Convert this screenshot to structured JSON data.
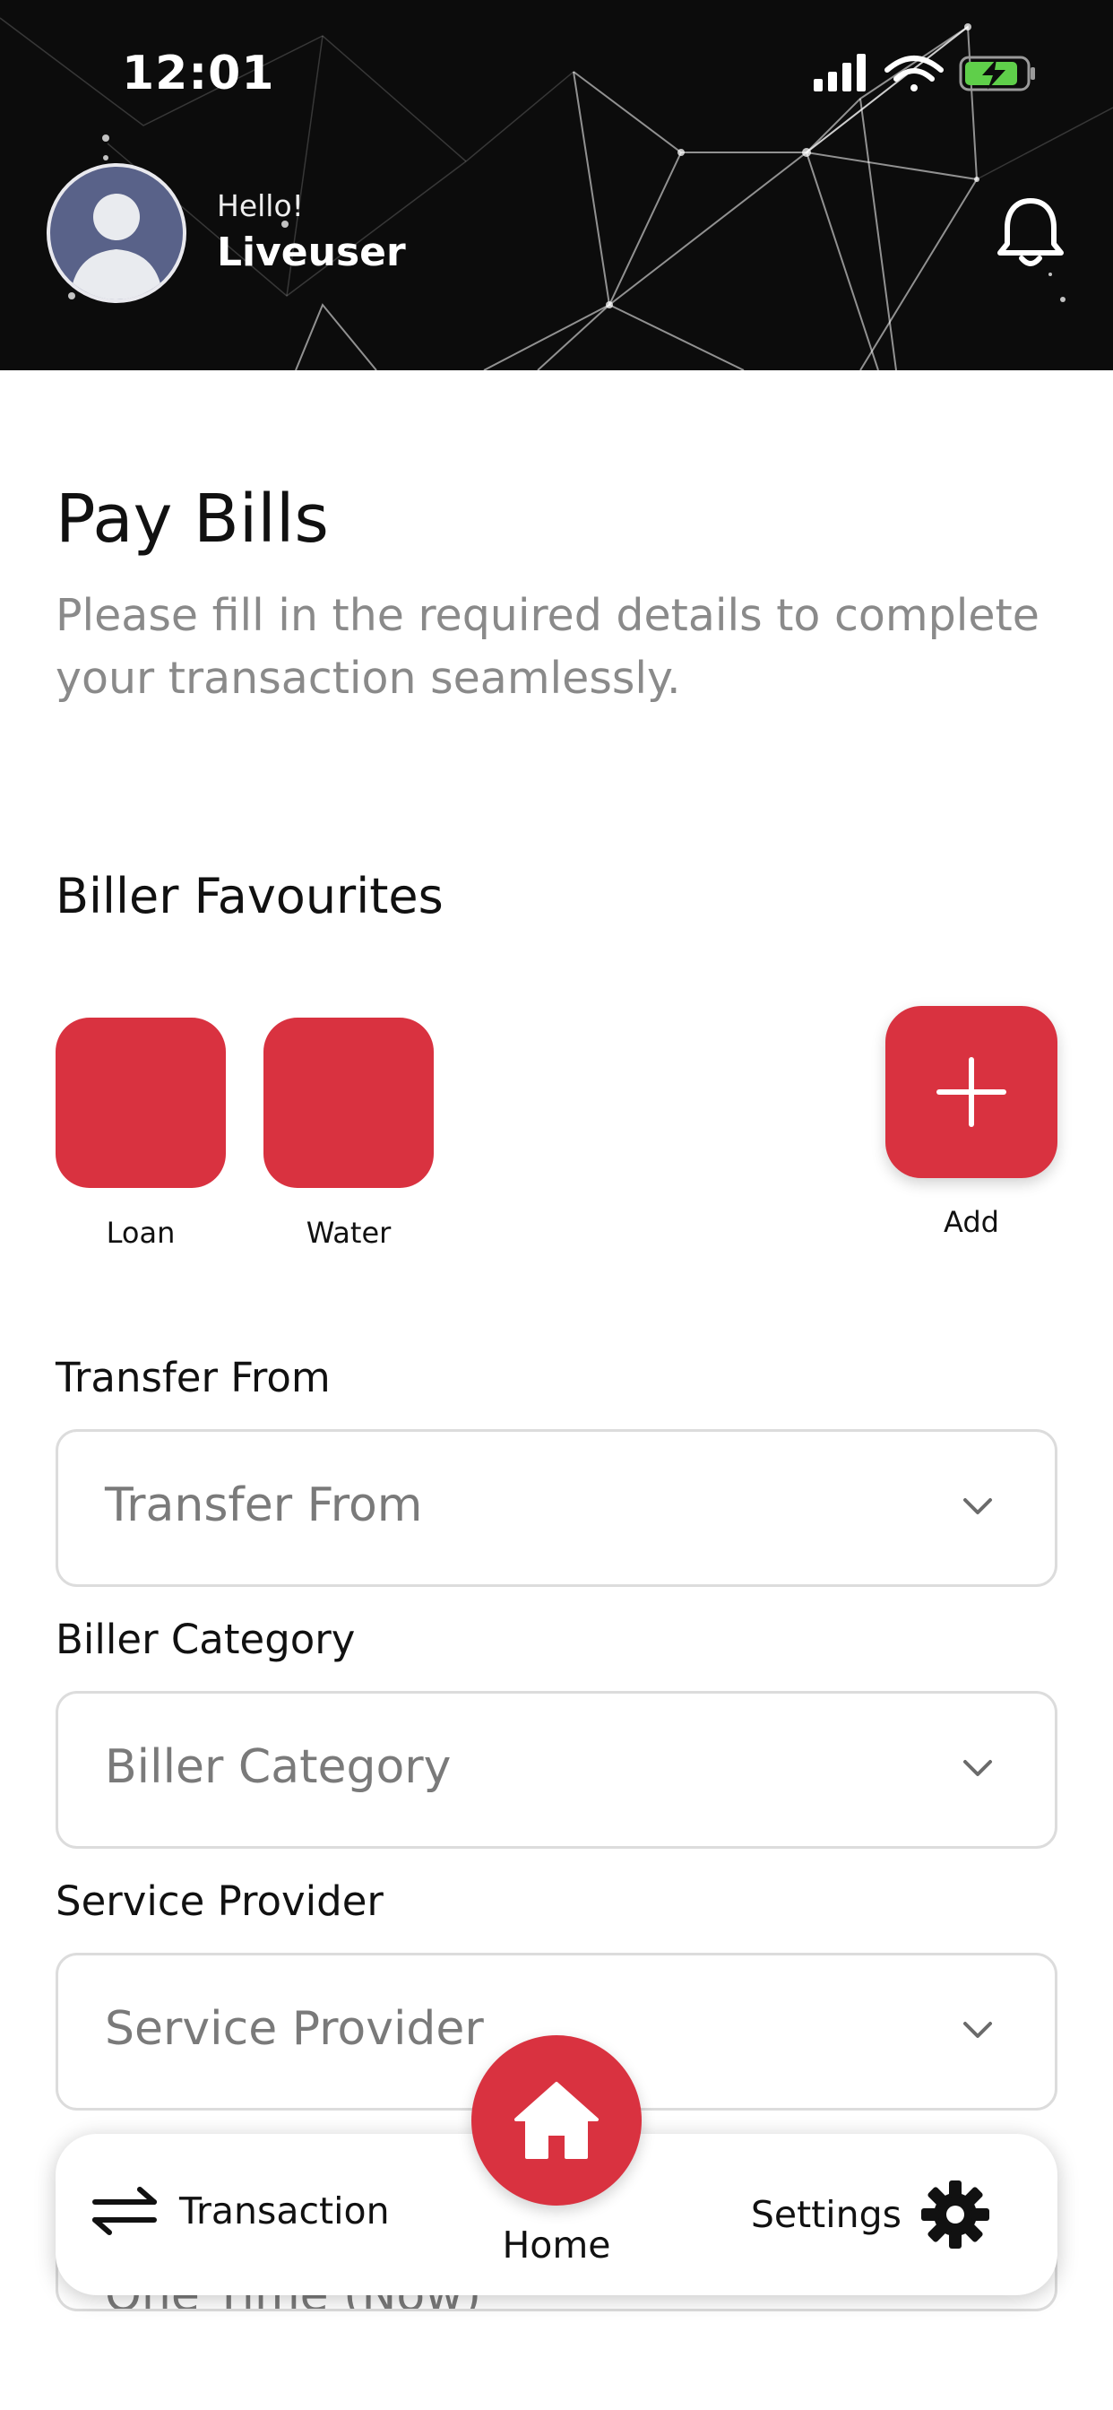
{
  "status_bar": {
    "time": "12:01"
  },
  "header": {
    "greeting": "Hello!",
    "username": "Liveuser"
  },
  "page": {
    "title": "Pay Bills",
    "subtitle": "Please fill in the required details to complete your transaction seamlessly."
  },
  "favourites": {
    "title": "Biller Favourites",
    "items": [
      {
        "label": "Loan"
      },
      {
        "label": "Water"
      }
    ],
    "add_label": "Add"
  },
  "form": {
    "transfer_from": {
      "label": "Transfer From",
      "placeholder": "Transfer From"
    },
    "biller_category": {
      "label": "Biller Category",
      "placeholder": "Biller Category"
    },
    "service_provider": {
      "label": "Service Provider",
      "placeholder": "Service Provider"
    },
    "schedule": {
      "placeholder": "One Time (Now)"
    }
  },
  "nav": {
    "transaction": "Transaction",
    "home": "Home",
    "settings": "Settings"
  },
  "colors": {
    "accent": "#d93240",
    "header_bg": "#0c0c0c",
    "muted_text": "#8a8a8a",
    "field_border": "#dcdcdc"
  }
}
